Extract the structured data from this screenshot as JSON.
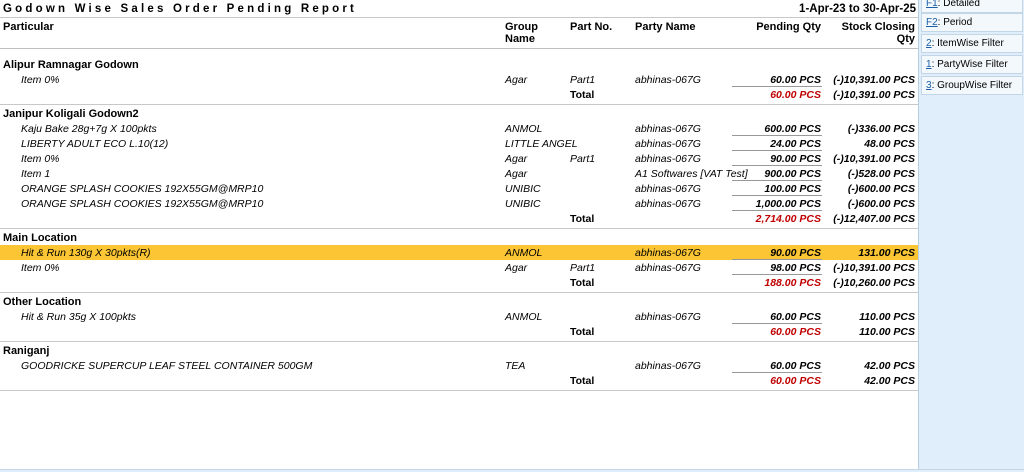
{
  "report": {
    "title": "Godown Wise Sales Order Pending Report",
    "period": "1-Apr-23 to 30-Apr-25"
  },
  "columns": {
    "particular": "Particular",
    "group_name_line1": "Group",
    "group_name_line2": "Name",
    "part_no": "Part No.",
    "party_name": "Party Name",
    "pending_qty": "Pending Qty",
    "stock_closing_line1": "Stock Closing",
    "stock_closing_line2": "Qty"
  },
  "godowns": [
    {
      "name": "Alipur Ramnagar Godown",
      "items": [
        {
          "item": "Item 0%",
          "group": "Agar",
          "part": "Part1",
          "party": "abhinas-067G",
          "pending": "60.00 PCS",
          "stock": "(-)10,391.00 PCS"
        }
      ],
      "total_label": "Total",
      "total_pending": "60.00 PCS",
      "total_stock": "(-)10,391.00 PCS"
    },
    {
      "name": "Janipur Koligali Godown2",
      "items": [
        {
          "item": "Kaju Bake 28g+7g X 100pkts",
          "group": "ANMOL",
          "part": "",
          "party": "abhinas-067G",
          "pending": "600.00 PCS",
          "stock": "(-)336.00 PCS"
        },
        {
          "item": "LIBERTY ADULT ECO L.10(12)",
          "group": "LITTLE ANGEL",
          "part": "",
          "party": "abhinas-067G",
          "pending": "24.00 PCS",
          "stock": "48.00 PCS"
        },
        {
          "item": "Item 0%",
          "group": "Agar",
          "part": "Part1",
          "party": "abhinas-067G",
          "pending": "90.00 PCS",
          "stock": "(-)10,391.00 PCS"
        },
        {
          "item": "Item 1",
          "group": "Agar",
          "part": "",
          "party": "A1 Softwares [VAT Test]",
          "pending": "900.00 PCS",
          "stock": "(-)528.00 PCS"
        },
        {
          "item": "ORANGE SPLASH COOKIES 192X55GM@MRP10",
          "group": "UNIBIC",
          "part": "",
          "party": "abhinas-067G",
          "pending": "100.00 PCS",
          "stock": "(-)600.00 PCS"
        },
        {
          "item": "ORANGE SPLASH COOKIES 192X55GM@MRP10",
          "group": "UNIBIC",
          "part": "",
          "party": "abhinas-067G",
          "pending": "1,000.00 PCS",
          "stock": "(-)600.00 PCS"
        }
      ],
      "total_label": "Total",
      "total_pending": "2,714.00 PCS",
      "total_stock": "(-)12,407.00 PCS"
    },
    {
      "name": "Main Location",
      "items": [
        {
          "item": "Hit & Run 130g X 30pkts(R)",
          "group": "ANMOL",
          "part": "",
          "party": "abhinas-067G",
          "pending": "90.00 PCS",
          "stock": "131.00 PCS"
        },
        {
          "item": "Item 0%",
          "group": "Agar",
          "part": "Part1",
          "party": "abhinas-067G",
          "pending": "98.00 PCS",
          "stock": "(-)10,391.00 PCS"
        }
      ],
      "total_label": "Total",
      "total_pending": "188.00 PCS",
      "total_stock": "(-)10,260.00 PCS"
    },
    {
      "name": "Other Location",
      "items": [
        {
          "item": "Hit & Run 35g X 100pkts",
          "group": "ANMOL",
          "part": "",
          "party": "abhinas-067G",
          "pending": "60.00 PCS",
          "stock": "110.00 PCS"
        }
      ],
      "total_label": "Total",
      "total_pending": "60.00 PCS",
      "total_stock": "110.00 PCS"
    },
    {
      "name": "Raniganj",
      "items": [
        {
          "item": "GOODRICKE SUPERCUP LEAF STEEL CONTAINER 500GM",
          "group": "TEA",
          "part": "",
          "party": "abhinas-067G",
          "pending": "60.00 PCS",
          "stock": "42.00 PCS"
        }
      ],
      "total_label": "Total",
      "total_pending": "60.00 PCS",
      "total_stock": "42.00 PCS"
    }
  ],
  "selected_row": "Hit & Run 130g X 30pkts(R)",
  "side_buttons": [
    {
      "key": "F1",
      "label": ": Detailed"
    },
    {
      "key": "F2",
      "label": ": Period"
    },
    {
      "key": "2",
      "label": ": ItemWise Filter"
    },
    {
      "key": "1",
      "label": ": PartyWise Filter"
    },
    {
      "key": "3",
      "label": ": GroupWise Filter"
    }
  ],
  "colors": {
    "highlight": "#fbc534",
    "total_pending": "#c00000",
    "side_panel": "#dfeefa",
    "key_link": "#1a5fa8"
  }
}
